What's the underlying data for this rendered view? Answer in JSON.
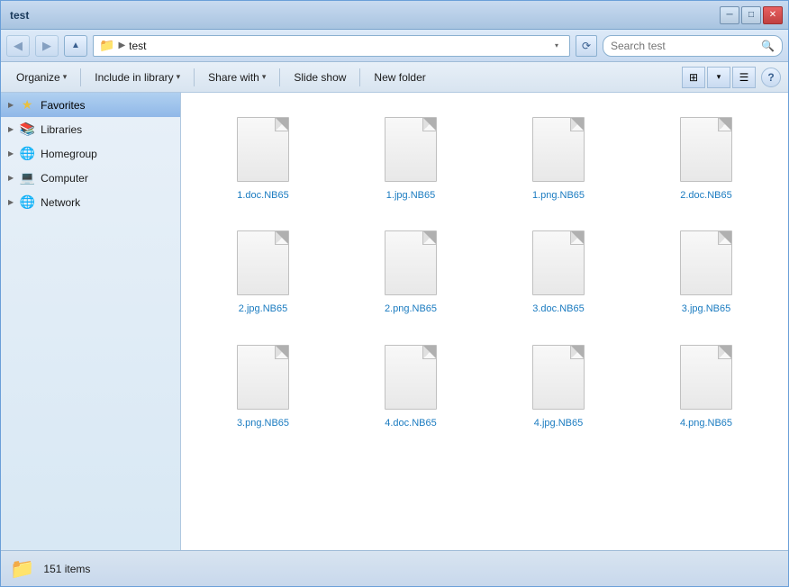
{
  "window": {
    "title": "test",
    "min_label": "─",
    "max_label": "□",
    "close_label": "✕"
  },
  "address": {
    "path_icon": "📁",
    "path_arrow": "▶",
    "path_text": "test",
    "search_placeholder": "Search test",
    "refresh_symbol": "⟳"
  },
  "toolbar": {
    "organize": "Organize",
    "include_in": "Include in library",
    "share_with": "Share with",
    "slide_show": "Slide show",
    "new_folder": "New folder",
    "dropdown_arrow": "▾",
    "help": "?"
  },
  "sidebar": {
    "items": [
      {
        "label": "Favorites",
        "icon": "★",
        "type": "star",
        "selected": true
      },
      {
        "label": "Libraries",
        "icon": "📚",
        "type": "libraries",
        "selected": false
      },
      {
        "label": "Homegroup",
        "icon": "🌐",
        "type": "homegroup",
        "selected": false
      },
      {
        "label": "Computer",
        "icon": "💻",
        "type": "computer",
        "selected": false
      },
      {
        "label": "Network",
        "icon": "🌐",
        "type": "network",
        "selected": false
      }
    ]
  },
  "files": [
    {
      "name": "1.doc.NB65"
    },
    {
      "name": "1.jpg.NB65"
    },
    {
      "name": "1.png.NB65"
    },
    {
      "name": "2.doc.NB65"
    },
    {
      "name": "2.jpg.NB65"
    },
    {
      "name": "2.png.NB65"
    },
    {
      "name": "3.doc.NB65"
    },
    {
      "name": "3.jpg.NB65"
    },
    {
      "name": "3.png.NB65"
    },
    {
      "name": "4.doc.NB65"
    },
    {
      "name": "4.jpg.NB65"
    },
    {
      "name": "4.png.NB65"
    }
  ],
  "status": {
    "item_count": "151 items",
    "folder_icon": "📁"
  }
}
